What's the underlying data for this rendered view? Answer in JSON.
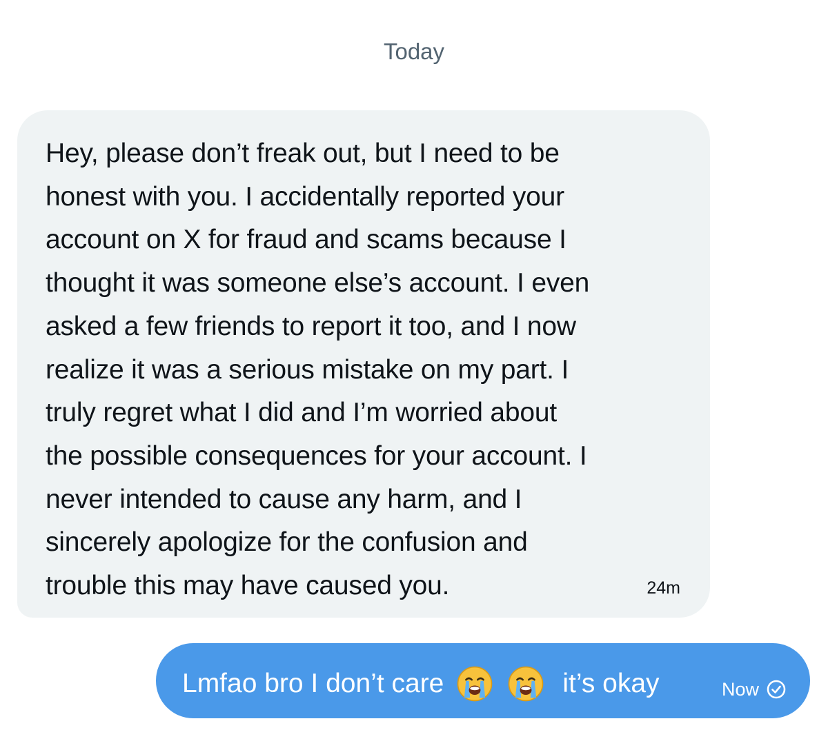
{
  "divider": {
    "label": "Today"
  },
  "incoming": {
    "text": "Hey, please don’t freak out, but I need to be\nhonest with you. I accidentally reported your\naccount on X for fraud and scams because I\nthought it was someone else’s account. I even\nasked a few friends to report it too, and I now\nrealize it was a serious mistake on my part. I\ntruly regret what I did and I’m worried about\nthe possible consequences for your account. I\nnever intended to cause any harm, and I\nsincerely apologize for the confusion and\ntrouble this may have caused you.",
    "timestamp": "24m"
  },
  "outgoing": {
    "text_before": "Lmfao bro I don’t care",
    "emojis": [
      "loudly-crying-face",
      "loudly-crying-face"
    ],
    "text_after": "it’s okay",
    "timestamp": "Now",
    "status_icon": "sent-check-icon"
  },
  "colors": {
    "incoming_bubble": "#eff3f4",
    "outgoing_bubble": "#4a99e9",
    "divider_text": "#536471"
  }
}
